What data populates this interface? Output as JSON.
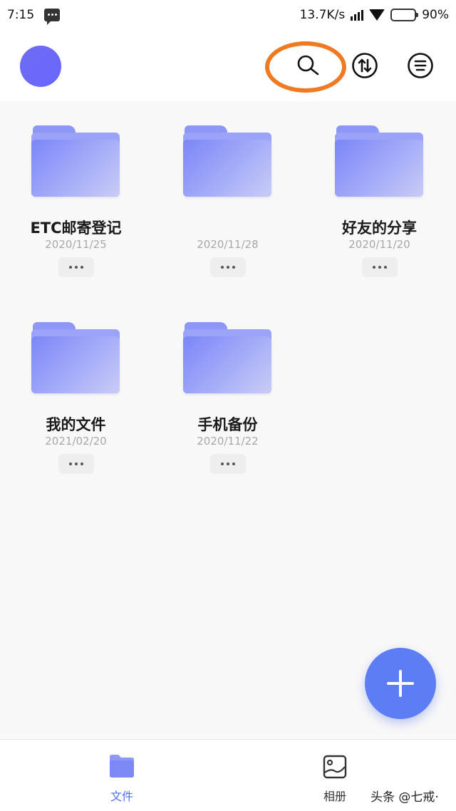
{
  "status_bar": {
    "time": "7:15",
    "network_speed": "13.7K/s",
    "battery": "90%",
    "battery_level": 0.9
  },
  "header": {
    "search_icon": "search-icon",
    "transfer_icon": "transfer-icon",
    "menu_icon": "menu-icon"
  },
  "folders": [
    {
      "name": "ETC邮寄登记",
      "date": "2020/11/25"
    },
    {
      "name": "",
      "date": "2020/11/28"
    },
    {
      "name": "好友的分享",
      "date": "2020/11/20"
    },
    {
      "name": "我的文件",
      "date": "2021/02/20"
    },
    {
      "name": "手机备份",
      "date": "2020/11/22"
    }
  ],
  "fab": {
    "icon": "plus-icon"
  },
  "bottom_nav": {
    "files_label": "文件",
    "album_label": "相册"
  },
  "watermark": "头条 @七戒·",
  "colors": {
    "accent": "#5d7df5",
    "highlight_ring": "#f07a21",
    "folder": "#8c97f6"
  }
}
